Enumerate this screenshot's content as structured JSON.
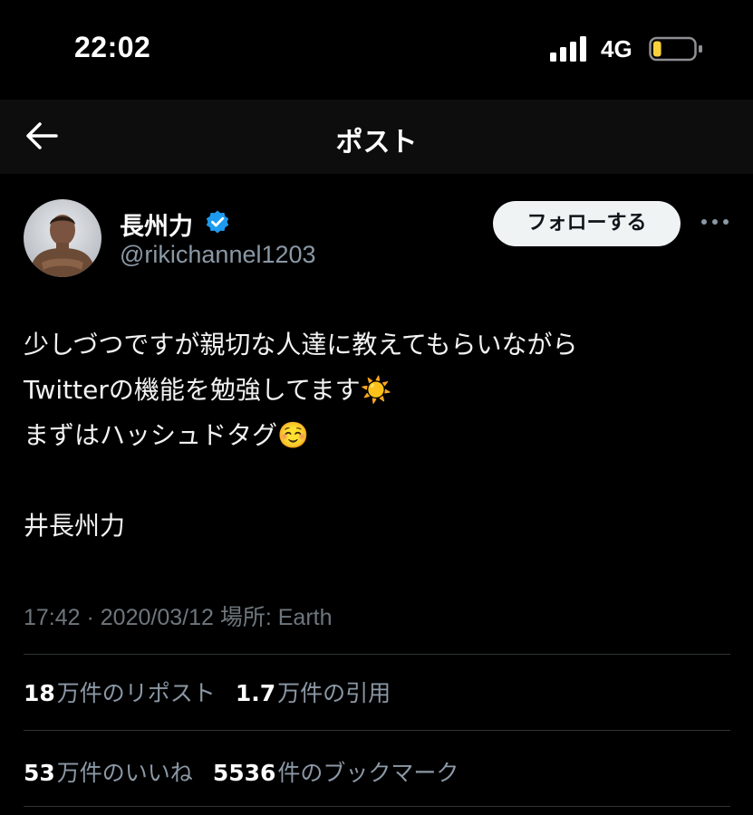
{
  "status_bar": {
    "time": "22:02",
    "network": "4G",
    "battery_level": 0.2,
    "battery_color": "#f7d23b"
  },
  "nav": {
    "title": "ポスト",
    "back_icon": "arrow-left-icon"
  },
  "author": {
    "display_name": "長州力",
    "handle": "@rikichannel1203",
    "verified": true,
    "verified_color": "#1d9bf0",
    "follow_label": "フォローする"
  },
  "tweet": {
    "lines": [
      "少しづつですが親切な人達に教えてもらいながら",
      "Twitterの機能を勉強してます☀️",
      "まずはハッシュドタグ☺️",
      "",
      "井長州力"
    ]
  },
  "meta": {
    "timestamp": "17:42 · 2020/03/12 場所: Earth"
  },
  "stats": {
    "reposts_num": "18",
    "reposts_label": "万件のリポスト",
    "quotes_num": "1.7",
    "quotes_label": "万件の引用",
    "likes_num": "53",
    "likes_label": "万件のいいね",
    "bookmarks_num": "5536",
    "bookmarks_label": "件のブックマーク"
  }
}
